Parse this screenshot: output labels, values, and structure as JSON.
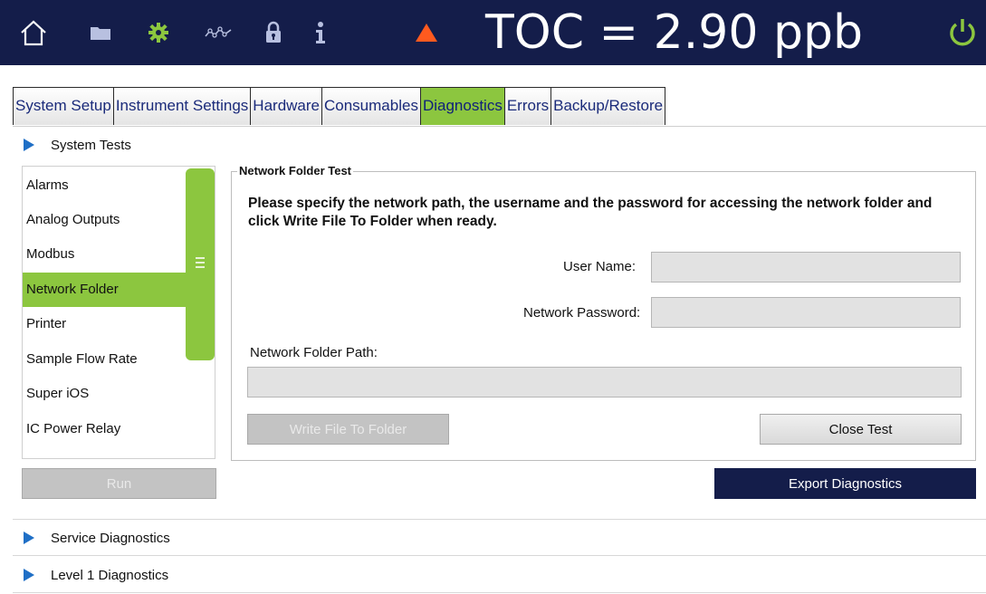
{
  "header": {
    "icons": [
      "home-icon",
      "folder-icon",
      "gear-icon",
      "trend-icon",
      "lock-icon",
      "info-icon",
      "alert-icon",
      "power-icon"
    ],
    "toc_display": "TOC = 2.90 ppb",
    "colors": {
      "bar": "#141d4a",
      "accent": "#8cc63f",
      "alert": "#ff5a1f"
    }
  },
  "tabs": [
    {
      "label": "System Setup",
      "active": false
    },
    {
      "label": "Instrument Settings",
      "active": false
    },
    {
      "label": "Hardware",
      "active": false
    },
    {
      "label": "Consumables",
      "active": false
    },
    {
      "label": "Diagnostics",
      "active": true
    },
    {
      "label": "Errors",
      "active": false
    },
    {
      "label": "Backup/Restore",
      "active": false
    }
  ],
  "sections": {
    "system_tests": "System Tests",
    "service_diagnostics": "Service Diagnostics",
    "level1_diagnostics": "Level 1 Diagnostics"
  },
  "test_list": {
    "items": [
      "Alarms",
      "Analog Outputs",
      "Modbus",
      "Network Folder",
      "Printer",
      "Sample Flow Rate",
      "Super iOS",
      "IC Power Relay"
    ],
    "selected": "Network Folder",
    "run_label": "Run"
  },
  "network_test": {
    "title": "Network Folder Test",
    "instructions": "Please specify the network path, the username and the password for accessing the network folder and click Write File To Folder when ready.",
    "user_name_label": "User Name:",
    "user_name_value": "",
    "password_label": "Network Password:",
    "password_value": "",
    "path_label": "Network Folder Path:",
    "path_value": "",
    "write_button": "Write File To Folder",
    "close_button": "Close Test"
  },
  "export_button": "Export Diagnostics"
}
